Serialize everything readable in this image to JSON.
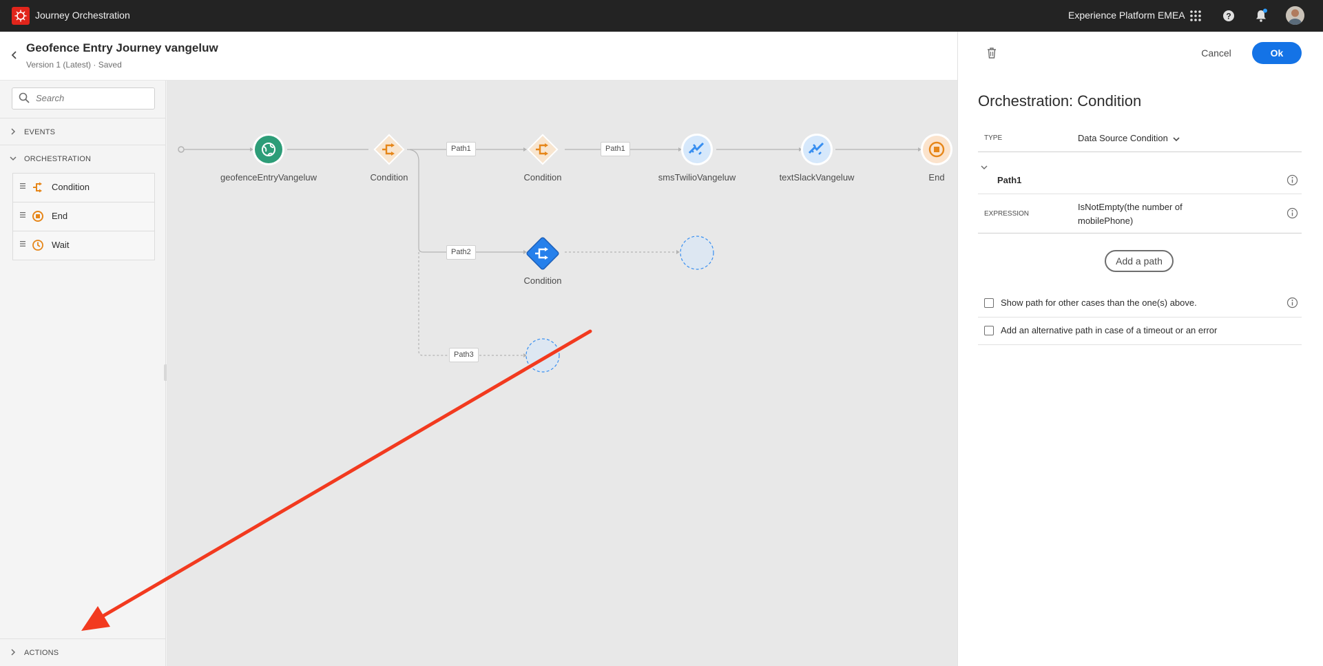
{
  "topbar": {
    "app_title": "Journey Orchestration",
    "org_name": "Experience Platform EMEA",
    "icons": [
      "apps-grid-icon",
      "help-icon",
      "notification-bell-icon",
      "user-avatar"
    ]
  },
  "header": {
    "title": "Geofence Entry Journey vangeluw",
    "version": "Version 1 (Latest) · Saved"
  },
  "left_panel": {
    "search_placeholder": "Search",
    "sections": {
      "events": "EVENTS",
      "orchestration": "ORCHESTRATION",
      "actions": "ACTIONS"
    },
    "orchestration_items": [
      {
        "label": "Condition",
        "icon": "condition-icon"
      },
      {
        "label": "End",
        "icon": "end-icon"
      },
      {
        "label": "Wait",
        "icon": "wait-clock-icon"
      }
    ]
  },
  "canvas": {
    "nodes": [
      {
        "label": "geofenceEntryVangeluw",
        "type": "event"
      },
      {
        "label": "Condition",
        "type": "condition"
      },
      {
        "label": "Condition",
        "type": "condition"
      },
      {
        "label": "smsTwilioVangeluw",
        "type": "action"
      },
      {
        "label": "textSlackVangeluw",
        "type": "action"
      },
      {
        "label": "End",
        "type": "end"
      },
      {
        "label": "Condition",
        "type": "condition-selected"
      }
    ],
    "path_tags": [
      "Path1",
      "Path1",
      "Path2",
      "Path3"
    ]
  },
  "right_panel": {
    "cancel_label": "Cancel",
    "ok_label": "Ok",
    "title": "Orchestration: Condition",
    "type_label": "TYPE",
    "type_value": "Data Source Condition",
    "path_name": "Path1",
    "expression_label": "EXPRESSION",
    "expression_value": "IsNotEmpty(the number of mobilePhone)",
    "add_path_label": "Add a path",
    "checkbox_other": "Show path for other cases than the one(s) above.",
    "checkbox_timeout": "Add an alternative path in case of a timeout or an error"
  },
  "colors": {
    "accent_blue": "#1473e6",
    "brand_red": "#e1251b",
    "condition_orange": "#e68619",
    "annotation_red": "#f23a1f"
  }
}
